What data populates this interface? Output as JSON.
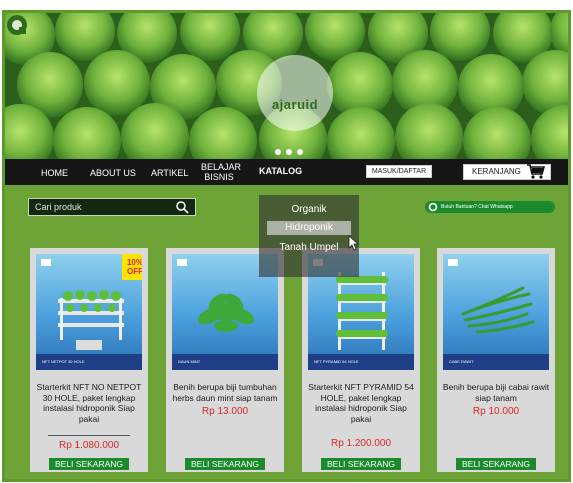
{
  "site": {
    "logo_text": "ajaruid"
  },
  "colors": {
    "brand_green": "#6ea338",
    "button_green": "#1a8a2c",
    "nav_black": "#161616",
    "price_red": "#d8282a",
    "badge_yellow": "#ffe400"
  },
  "hero": {
    "icon": "lettuce-photo",
    "slide_count": 3
  },
  "nav": {
    "items": [
      "HOME",
      "ABOUT US",
      "ARTIKEL",
      "BELAJAR BISNIS",
      "KATALOG"
    ],
    "active": "KATALOG",
    "login_label": "MASUK/DAFTAR",
    "cart_label": "KERANJANG",
    "cart_icon": "cart-icon"
  },
  "search": {
    "placeholder": "Cari produk",
    "icon": "search-icon"
  },
  "whatsapp": {
    "label": "Butuh Bantuan? Chat Whatsapp",
    "icon": "whatsapp-icon"
  },
  "dropdown": {
    "items": [
      "Organik",
      "Hidroponik",
      "Tanah Umpel"
    ],
    "highlighted": "Hidroponik"
  },
  "products": [
    {
      "tag": "NFT NETPOT 30 HOLE",
      "badge": "10% OFF",
      "title": "Starterkit NFT NO NETPOT 30 HOLE, paket lengkap instalasi hidroponik Siap pakai",
      "price": "Rp 1.080.000",
      "buy_label": "BELI SEKARANG"
    },
    {
      "tag": "DAUN MINT",
      "badge": "",
      "title": "Benih berupa biji tumbuhan herbs daun mint siap tanam",
      "price": "Rp 13.000",
      "buy_label": "BELI SEKARANG"
    },
    {
      "tag": "NFT PYRAMID 54 HOLE",
      "badge": "",
      "title": "Starterkit NFT PYRAMID 54 HOLE, paket lengkap instalasi hidroponik Siap pakai",
      "price": "Rp 1.200.000",
      "buy_label": "BELI SEKARANG"
    },
    {
      "tag": "CABE RAWIT",
      "badge": "",
      "title": "Benih berupa biji cabai rawit siap tanam",
      "price": "Rp 10.000",
      "buy_label": "BELI SEKARANG"
    }
  ]
}
